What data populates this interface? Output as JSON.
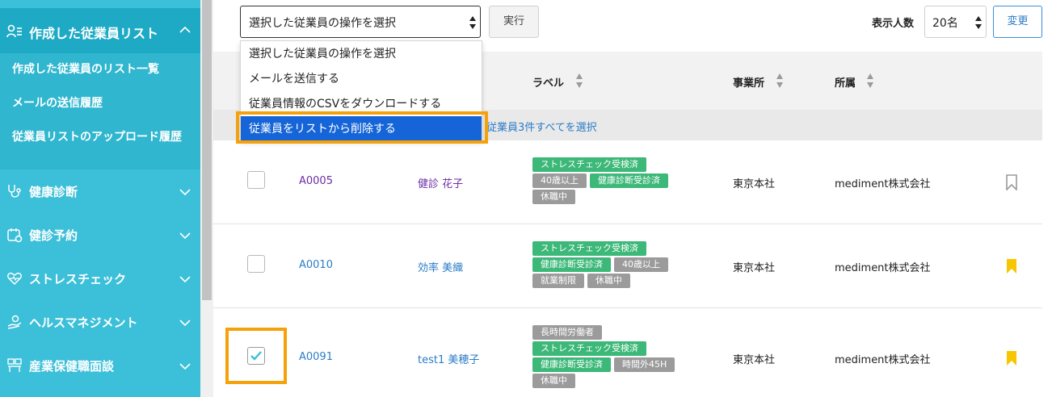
{
  "sidebar": {
    "section_title": "作成した従業員リスト",
    "sub_items": [
      "作成した従業員のリスト一覧",
      "メールの送信履歴",
      "従業員リストのアップロード履歴"
    ],
    "nav_items": [
      {
        "label": "健康診断",
        "icon": "stethoscope-icon"
      },
      {
        "label": "健診予約",
        "icon": "calendar-icon"
      },
      {
        "label": "ストレスチェック",
        "icon": "heart-icon"
      },
      {
        "label": "ヘルスマネジメント",
        "icon": "health-hand-icon"
      },
      {
        "label": "産業保健職面談",
        "icon": "interview-icon"
      }
    ]
  },
  "toolbar": {
    "action_value": "選択した従業員の操作を選択",
    "exec_label": "実行",
    "count_label": "表示人数",
    "count_value": "20名",
    "change_label": "変更"
  },
  "dropdown": {
    "options": [
      "選択した従業員の操作を選択",
      "メールを送信する",
      "従業員情報のCSVをダウンロードする",
      "従業員をリストから削除する"
    ],
    "selected_index": 3
  },
  "table": {
    "headers": {
      "label": "ラベル",
      "office": "事業所",
      "department": "所属"
    },
    "select_all_text": "従業員3件すべてを選択",
    "rows": [
      {
        "checked": false,
        "id": "A0005",
        "name": "健診 花子",
        "tags": [
          [
            "ストレスチェック受検済"
          ],
          [
            "40歳以上",
            "健康診断受診済"
          ],
          [
            "休職中"
          ]
        ],
        "tag_colors": [
          [
            "green"
          ],
          [
            "gray",
            "green"
          ],
          [
            "gray"
          ]
        ],
        "office": "東京本社",
        "department": "mediment株式会社",
        "bookmarked": false
      },
      {
        "checked": false,
        "id": "A0010",
        "name": "効率 美織",
        "tags": [
          [
            "ストレスチェック受検済"
          ],
          [
            "健康診断受診済",
            "40歳以上"
          ],
          [
            "就業制限",
            "休職中"
          ]
        ],
        "tag_colors": [
          [
            "green"
          ],
          [
            "green",
            "gray"
          ],
          [
            "gray",
            "gray"
          ]
        ],
        "office": "東京本社",
        "department": "mediment株式会社",
        "bookmarked": true
      },
      {
        "checked": true,
        "id": "A0091",
        "name": "test1 美穂子",
        "tags": [
          [
            "長時間労働者"
          ],
          [
            "ストレスチェック受検済"
          ],
          [
            "健康診断受診済",
            "時間外45H"
          ],
          [
            "休職中"
          ]
        ],
        "tag_colors": [
          [
            "gray"
          ],
          [
            "green"
          ],
          [
            "green",
            "gray"
          ],
          [
            "gray"
          ]
        ],
        "office": "東京本社",
        "department": "mediment株式会社",
        "bookmarked": true
      }
    ]
  },
  "colors": {
    "sidebar_bg": "#3cbfd8",
    "sidebar_section": "#1eaac5",
    "link": "#2b7cc7",
    "tag_green": "#3cb878",
    "tag_gray": "#9b9b9b",
    "highlight": "#f5a20a",
    "dropdown_selected": "#1565d8",
    "bookmark_active": "#f7c600"
  }
}
